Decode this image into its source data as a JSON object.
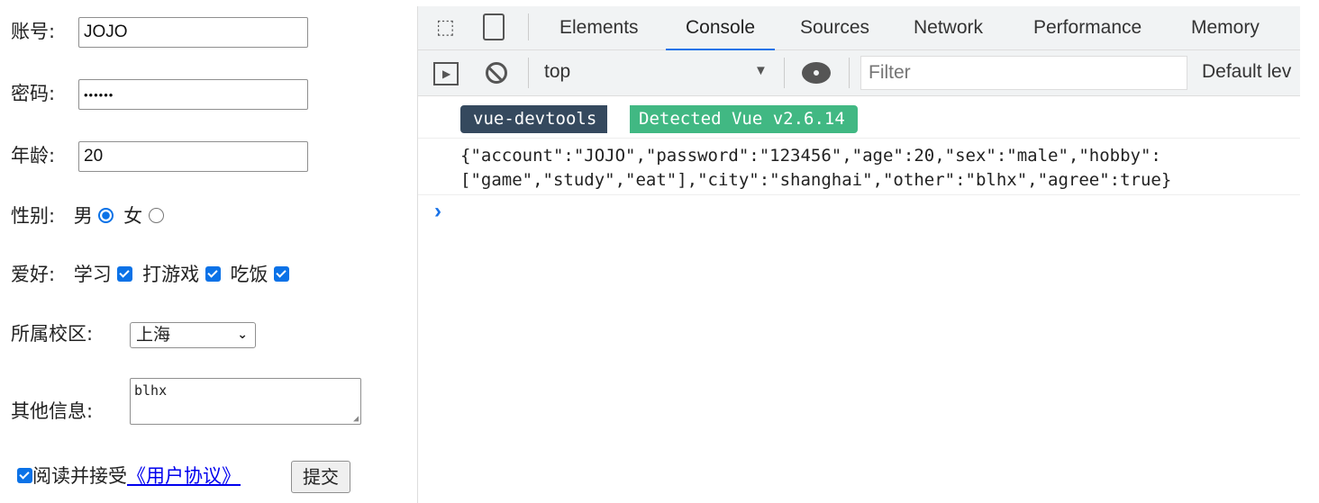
{
  "form": {
    "account_label": "账号:",
    "account_value": "JOJO",
    "password_label": "密码:",
    "password_value": "••••••",
    "age_label": "年龄:",
    "age_value": "20",
    "sex_label": "性别:",
    "sex_options": [
      "男",
      "女"
    ],
    "sex_selected": "男",
    "hobby_label": "爱好:",
    "hobbies": [
      "学习",
      "打游戏",
      "吃饭"
    ],
    "campus_label": "所属校区:",
    "campus_value": "上海",
    "other_label": "其他信息:",
    "other_value": "blhx",
    "agree_text": "阅读并接受",
    "agree_link": "《用户协议》",
    "submit_label": "提交"
  },
  "devtools": {
    "tabs": [
      "Elements",
      "Console",
      "Sources",
      "Network",
      "Performance",
      "Memory"
    ],
    "active_tab": "Console",
    "context": "top",
    "filter_placeholder": "Filter",
    "levels": "Default lev",
    "badge_left": "vue-devtools",
    "badge_right": "Detected Vue v2.6.14",
    "log_line1": "{\"account\":\"JOJO\",\"password\":\"123456\",\"age\":20,\"sex\":\"male\",\"hobby\":",
    "log_line2": "[\"game\",\"study\",\"eat\"],\"city\":\"shanghai\",\"other\":\"blhx\",\"agree\":true}",
    "prompt": "›"
  },
  "colors": {
    "accent": "#1a73e8",
    "vue_dark": "#35495e",
    "vue_green": "#41b883",
    "link": "#0000ee"
  }
}
